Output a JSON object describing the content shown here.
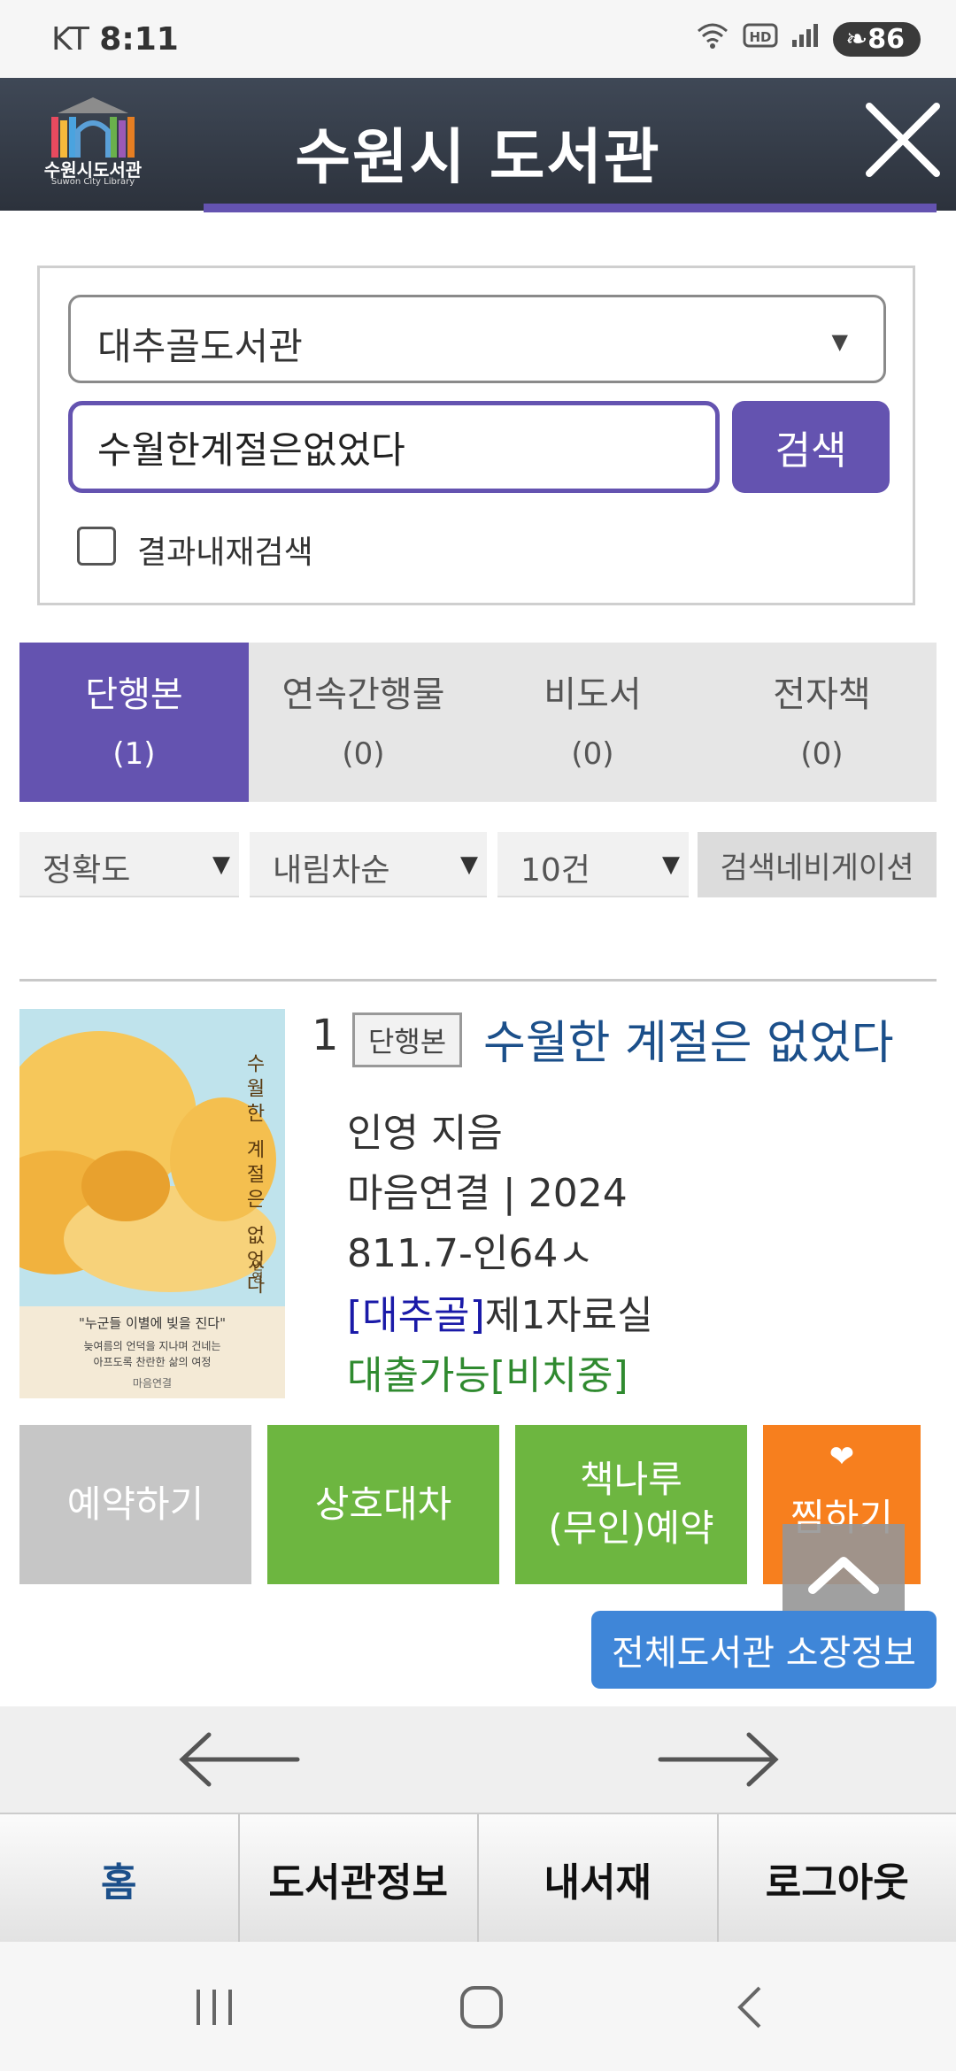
{
  "status_bar": {
    "carrier": "KT",
    "time": "8:11",
    "battery": "86",
    "icons": [
      "wifi-5-icon",
      "hd-icon",
      "signal-icon",
      "battery-saver-icon"
    ]
  },
  "header": {
    "logo_text": "수원시도서관",
    "logo_subtext": "Suwon City Library",
    "title": "수원시 도서관"
  },
  "search": {
    "library_selected": "대추골도서관",
    "query": "수월한계절은없었다",
    "button_label": "검색",
    "refine_label": "결과내재검색"
  },
  "tabs": [
    {
      "label": "단행본",
      "count": "(1)",
      "active": true
    },
    {
      "label": "연속간행물",
      "count": "(0)",
      "active": false
    },
    {
      "label": "비도서",
      "count": "(0)",
      "active": false
    },
    {
      "label": "전자책",
      "count": "(0)",
      "active": false
    }
  ],
  "filters": {
    "sort_by": "정확도",
    "order": "내림차순",
    "page_size": "10건",
    "navigation_label": "검색네비게이션"
  },
  "result": {
    "number": "1",
    "type_badge": "단행본",
    "title": "수월한 계절은 없었다",
    "author": "인영 지음",
    "publisher_year": "마음연결 | 2024",
    "call_number": "811.7-인64ㅅ",
    "location_library": "[대추골]",
    "location_room": "제1자료실",
    "availability": "대출가능[비치중]",
    "cover": {
      "vertical_title": "수월한 계절은 없었다",
      "author": "인영",
      "quote": "\"누군들 이별에 빚을 진다\"",
      "blurb": [
        "늦여름의 언덕을 지나며 건네는",
        "아프도록 찬란한 삶의 여정"
      ],
      "publisher": "마음연결"
    }
  },
  "actions": {
    "reserve": "예약하기",
    "interlibrary": "상호대차",
    "booknaru_line1": "책나루",
    "booknaru_line2": "(무인)예약",
    "like": "찜하기",
    "all_holdings": "전체도서관 소장정보"
  },
  "bottom_menu": [
    "홈",
    "도서관정보",
    "내서재",
    "로그아웃"
  ],
  "colors": {
    "accent_purple": "#6453b0",
    "header_dark": "#2c323c",
    "green": "#6db640",
    "orange": "#f77f1e",
    "blue_button": "#3f86d8",
    "title_blue": "#1b4f8a"
  }
}
